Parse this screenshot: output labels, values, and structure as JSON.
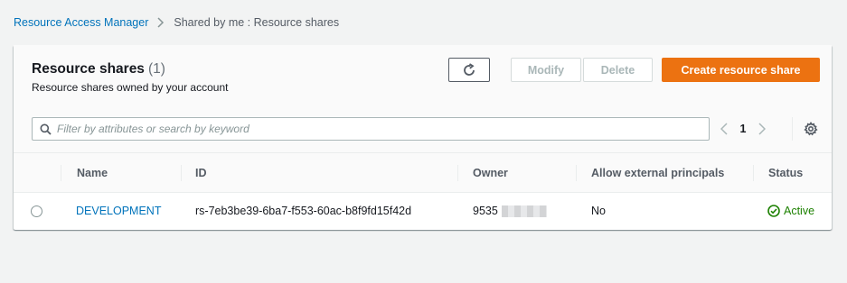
{
  "breadcrumb": {
    "root": "Resource Access Manager",
    "current": "Shared by me : Resource shares"
  },
  "header": {
    "title": "Resource shares",
    "count": "(1)",
    "subtitle": "Resource shares owned by your account"
  },
  "toolbar": {
    "refresh_icon": "refresh-icon",
    "modify_label": "Modify",
    "delete_label": "Delete",
    "create_label": "Create resource share"
  },
  "filter": {
    "placeholder": "Filter by attributes or search by keyword",
    "value": ""
  },
  "pagination": {
    "current_page": "1"
  },
  "table": {
    "columns": [
      "Name",
      "ID",
      "Owner",
      "Allow external principals",
      "Status"
    ],
    "rows": [
      {
        "name": "DEVELOPMENT",
        "id": "rs-7eb3be39-6ba7-f553-60ac-b8f9fd15f42d",
        "owner": "9535",
        "allow_external": "No",
        "status": "Active"
      }
    ]
  },
  "colors": {
    "accent": "#ec7211",
    "link": "#0073bb",
    "success": "#1d8102"
  }
}
